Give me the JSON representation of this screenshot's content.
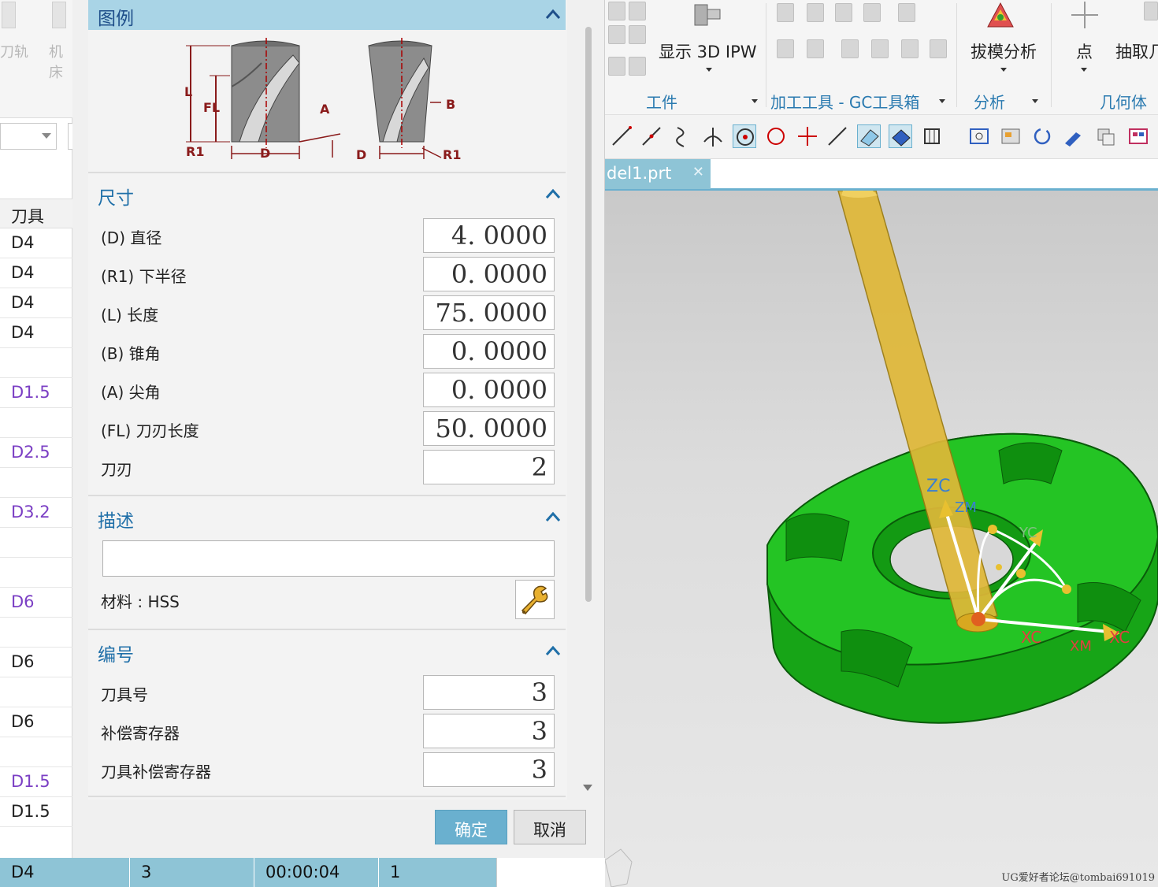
{
  "left_toolbar": {
    "labels": [
      "刀轨",
      "机床"
    ]
  },
  "tool_table": {
    "header": "刀具",
    "rows": [
      {
        "label": "D4",
        "style": "normal"
      },
      {
        "label": "D4",
        "style": "normal"
      },
      {
        "label": "D4",
        "style": "normal"
      },
      {
        "label": "D4",
        "style": "normal"
      },
      {
        "label": "",
        "style": "normal"
      },
      {
        "label": "D1.5",
        "style": "purple"
      },
      {
        "label": "",
        "style": "normal"
      },
      {
        "label": "D2.5",
        "style": "purple"
      },
      {
        "label": "",
        "style": "normal"
      },
      {
        "label": "D3.2",
        "style": "purple"
      },
      {
        "label": "",
        "style": "normal"
      },
      {
        "label": "",
        "style": "normal"
      },
      {
        "label": "D6",
        "style": "purple"
      },
      {
        "label": "",
        "style": "normal"
      },
      {
        "label": "D6",
        "style": "normal"
      },
      {
        "label": "",
        "style": "normal"
      },
      {
        "label": "D6",
        "style": "normal"
      },
      {
        "label": "",
        "style": "normal"
      },
      {
        "label": "D1.5",
        "style": "purple"
      },
      {
        "label": "D1.5",
        "style": "normal"
      }
    ]
  },
  "bottom_row": {
    "tool": "D4",
    "count": "3",
    "time": "00:00:04",
    "value": "1"
  },
  "dialog": {
    "legend": {
      "title": "图例",
      "labels": {
        "L": "L",
        "FL": "FL",
        "A": "A",
        "R1": "R1",
        "D": "D",
        "B": "B"
      }
    },
    "dimensions": {
      "title": "尺寸",
      "fields": [
        {
          "label": "(D) 直径",
          "value": "4. 0000"
        },
        {
          "label": "(R1) 下半径",
          "value": "0. 0000"
        },
        {
          "label": "(L) 长度",
          "value": "75. 0000"
        },
        {
          "label": "(B) 锥角",
          "value": "0. 0000"
        },
        {
          "label": "(A) 尖角",
          "value": "0. 0000"
        },
        {
          "label": "(FL) 刀刃长度",
          "value": "50. 0000"
        },
        {
          "label": "刀刃",
          "value": "2"
        }
      ]
    },
    "description": {
      "title": "描述",
      "input_value": "",
      "material_label": "材料 : HSS"
    },
    "numbering": {
      "title": "编号",
      "fields": [
        {
          "label": "刀具号",
          "value": "3"
        },
        {
          "label": "补偿寄存器",
          "value": "3"
        },
        {
          "label": "刀具补偿寄存器",
          "value": "3"
        }
      ]
    },
    "buttons": {
      "ok": "确定",
      "cancel": "取消"
    }
  },
  "ribbon": {
    "show_ipw": "显示 3D IPW",
    "draft_analysis": "拔模分析",
    "point": "点",
    "extract": "抽取几",
    "groups": {
      "workpiece": "工件",
      "tools": "加工工具 - GC工具箱",
      "analysis": "分析",
      "geometry": "几何体"
    }
  },
  "file_tab": {
    "name": "del1.prt"
  },
  "viewport": {
    "axis_labels": {
      "zc": "ZC",
      "zm": "ZM",
      "xc": "XC",
      "xm": "XM",
      "yc": "YC"
    },
    "watermark": "UG爱好者论坛@tombai691019"
  },
  "colors": {
    "part_green": "#1fb81f",
    "tool_yellow": "#e8c030",
    "accent_blue": "#6ab0cf",
    "header_blue": "#1f6fa8"
  }
}
